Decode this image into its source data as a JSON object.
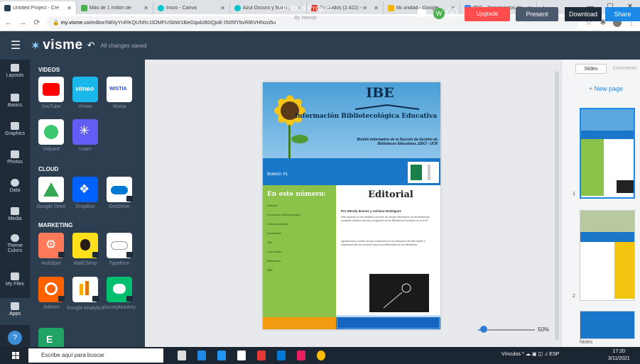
{
  "browser": {
    "tabs": [
      {
        "title": "Untitled Project - Cre",
        "color": "#2c3e50",
        "active": true
      },
      {
        "title": "Más de 1 millón de",
        "color": "#4caf50",
        "active": false
      },
      {
        "title": "Inicio - Canva",
        "color": "#00c4cc",
        "active": false
      },
      {
        "title": "Azul Oscuro y Naranj",
        "color": "#00c4cc",
        "active": false
      },
      {
        "title": "Recibidos (2.422) - w",
        "color": "#d93025",
        "active": false
      },
      {
        "title": "Mi unidad - Google",
        "color": "#f4b400",
        "active": false
      },
      {
        "title": "TFG - Documentos de",
        "color": "#4285f4",
        "active": false
      }
    ],
    "new_tab": "+",
    "url_host": "my.visme.co",
    "url_path": "/editor/NEtyYnRKQUhRc1lOMFUSbW1BeGtpdzB0QjoE-l505fYbvRl6VHNzo5u",
    "window_controls": [
      "—",
      "☐",
      "✕"
    ]
  },
  "toolbar": {
    "logo_text": "visme",
    "saved_status": "All changes saved",
    "project_title": "Untitled Project",
    "project_author": "By Wendy",
    "avatar_letter": "W",
    "upgrade_label": "Upgrade",
    "present_label": "Present",
    "download_label": "Download",
    "share_label": "Share"
  },
  "rail": [
    {
      "label": "Layouts"
    },
    {
      "label": "Basics"
    },
    {
      "label": "Graphics"
    },
    {
      "label": "Photos"
    },
    {
      "label": "Data"
    },
    {
      "label": "Media"
    },
    {
      "label": "Theme Colors"
    },
    {
      "label": "My Files"
    },
    {
      "label": "Apps"
    }
  ],
  "panel": {
    "videos_heading": "VIDEOS",
    "cloud_heading": "CLOUD",
    "marketing_heading": "MARKETING",
    "videos": [
      "YouTube",
      "Vimeo",
      "Wistia",
      "Vidyard",
      "Loom"
    ],
    "cloud": [
      "Google Drive",
      "DropBox",
      "OneDrive"
    ],
    "marketing": [
      "HubSpot",
      "MailChimp",
      "Typeform",
      "Jotform",
      "Google Analytics",
      "SurveyMonkey"
    ]
  },
  "document": {
    "ibe": "IBE",
    "info_title": "Información Bibliotecológica Educativa",
    "boletin_desc": "Boletín informativo de la Sección de Gestión de Bibliotecas Educativas, EBCI - UCR",
    "boletin_num": "Boletín #1",
    "en_este": "En este número:",
    "green_items": [
      "Editorial",
      "Formación bibliotecológica",
      "Consejo editorial",
      "Novedades",
      "Tips",
      "Comunidad",
      "Bibliotecas",
      "SBE"
    ],
    "editorial": "Editorial",
    "byline": "Por Wendy Brenes y Adriana Rodríguez",
    "para1": "Este proyecto se ha realizado con el fin de brindar información de las bibliotecas escolares públicas del país y la gestión de las Bibliotecas Escolares en la UCR.",
    "para2": "Agradecemos a todos los que colaboraron en la realización de este boletín y esperamos sea de provecho para los profesionales de las bibliotecas."
  },
  "canvas": {
    "zoom": "50%"
  },
  "right_panel": {
    "tab_slides": "Slides",
    "tab_comments": "Comments",
    "new_page": "+ New page",
    "thumb_numbers": [
      "1",
      "2"
    ],
    "notes_label": "Notes"
  },
  "taskbar": {
    "search_placeholder": "Escribe aquí para buscar",
    "tray_text": "Vínculos",
    "lang": "ESP",
    "time": "17:20",
    "date": "3/11/2021"
  }
}
